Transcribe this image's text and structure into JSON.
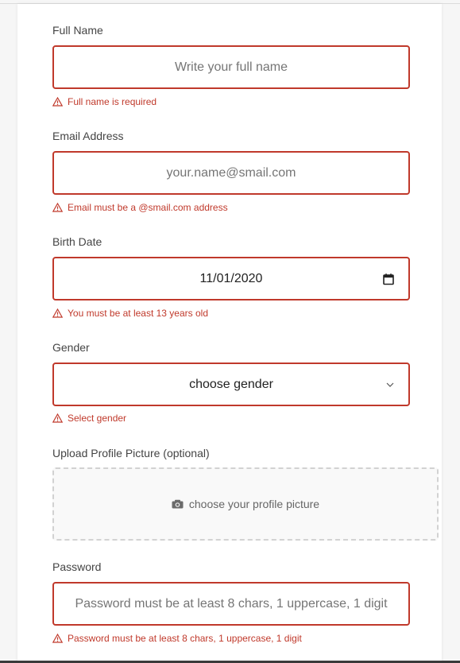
{
  "form": {
    "full_name": {
      "label": "Full Name",
      "placeholder": "Write your full name",
      "error": "Full name is required"
    },
    "email": {
      "label": "Email Address",
      "placeholder": "your.name@smail.com",
      "error": "Email must be a @smail.com address"
    },
    "birth_date": {
      "label": "Birth Date",
      "value": "11/01/2020",
      "error": "You must be at least 13 years old"
    },
    "gender": {
      "label": "Gender",
      "selected": "choose gender",
      "error": "Select gender"
    },
    "profile_picture": {
      "label": "Upload Profile Picture (optional)",
      "prompt": "choose your profile picture"
    },
    "password": {
      "label": "Password",
      "placeholder": "Password must be at least 8 chars, 1 uppercase, 1 digit",
      "error": "Password must be at least 8 chars, 1 uppercase, 1 digit"
    }
  },
  "icons": {
    "error": "warning-triangle-icon",
    "calendar": "calendar-icon",
    "dropdown": "chevron-down-icon",
    "upload": "camera-icon"
  },
  "colors": {
    "error": "#c0392b",
    "card": "#ffffff",
    "background": "#f6f6f6",
    "upload_border": "#d2d2d2"
  }
}
